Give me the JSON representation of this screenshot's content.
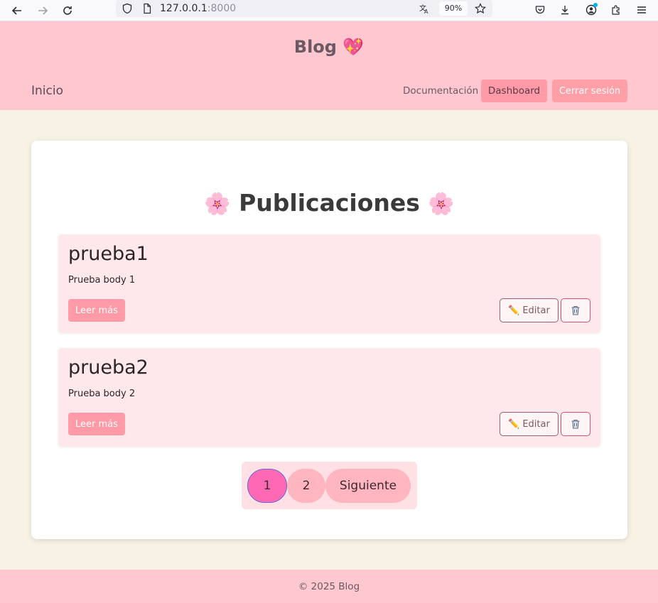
{
  "browser": {
    "url_host": "127.0.0.1",
    "url_port": ":8000",
    "zoom": "90%"
  },
  "header": {
    "brand": "Blog 💖",
    "home_link": "Inicio",
    "docs_link": "Documentación",
    "dashboard_button": "Dashboard",
    "logout_button": "Cerrar sesión"
  },
  "main": {
    "title": "Publicaciones",
    "title_icon": "🌸",
    "posts": [
      {
        "title": "prueba1",
        "body": "Prueba body 1",
        "read_more": "Leer más",
        "edit": "Editar"
      },
      {
        "title": "prueba2",
        "body": "Prueba body 2",
        "read_more": "Leer más",
        "edit": "Editar"
      }
    ],
    "pagination": {
      "pages": [
        "1",
        "2"
      ],
      "current_page": "1",
      "next": "Siguiente"
    }
  },
  "footer": {
    "text": "© 2025 Blog"
  },
  "colors": {
    "header_bg": "#ffc7cf",
    "page_bg": "#f8f2e4",
    "post_bg": "#ffe8ec",
    "accent": "#ff9aa6",
    "active_page": "#ff69b4"
  }
}
